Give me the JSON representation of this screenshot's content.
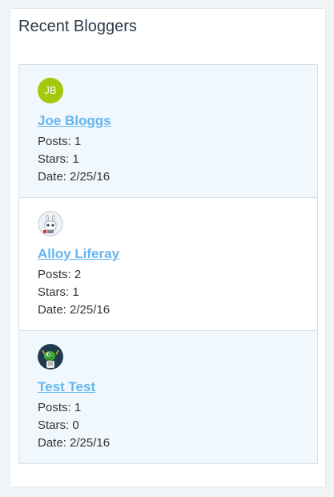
{
  "portlet": {
    "title": "Recent Bloggers"
  },
  "bloggers": [
    {
      "name": "Joe Bloggs",
      "avatar": {
        "type": "initials",
        "initials": "JB",
        "color": "#a5c70e"
      },
      "posts": "Posts: 1",
      "stars": "Stars: 1",
      "date": "Date: 2/25/16"
    },
    {
      "name": "Alloy Liferay",
      "avatar": {
        "type": "image",
        "icon": "alloy-robot-avatar-icon"
      },
      "posts": "Posts: 2",
      "stars": "Stars: 1",
      "date": "Date: 2/25/16"
    },
    {
      "name": "Test Test",
      "avatar": {
        "type": "image",
        "icon": "green-mascot-avatar-icon"
      },
      "posts": "Posts: 1",
      "stars": "Stars: 0",
      "date": "Date: 2/25/16"
    }
  ],
  "colors": {
    "link": "#65b6f0",
    "shaded_row": "#f0f8fe",
    "border": "#d6dde6",
    "page_background": "#f1f4f7"
  }
}
